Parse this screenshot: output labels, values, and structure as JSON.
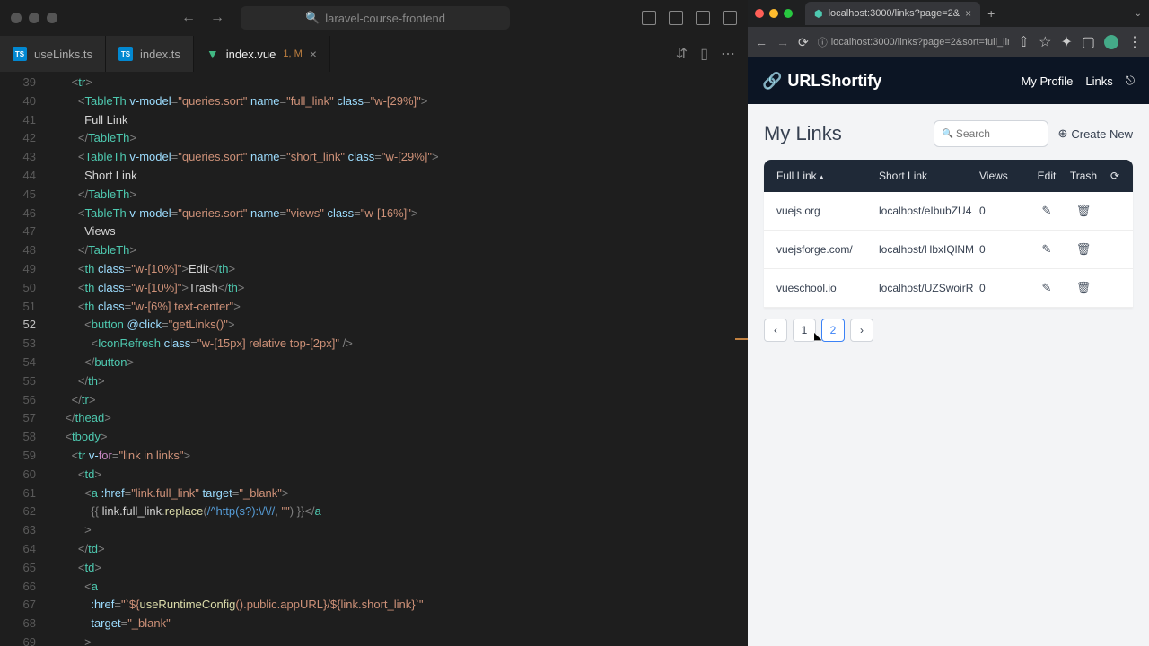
{
  "editor": {
    "project_name": "laravel-course-frontend",
    "tabs": [
      {
        "name": "useLinks.ts",
        "type": "ts"
      },
      {
        "name": "index.ts",
        "type": "ts"
      },
      {
        "name": "index.vue",
        "type": "vue",
        "suffix": "1, M"
      }
    ],
    "line_start": 39,
    "line_end": 69,
    "active_line": 52
  },
  "browser": {
    "tab_title": "localhost:3000/links?page=2&",
    "url_display": "localhost:3000/links?page=2&sort=full_link&fi..."
  },
  "app": {
    "brand": "URLShortify",
    "nav": {
      "profile": "My Profile",
      "links": "Links"
    },
    "page_title": "My Links",
    "search_placeholder": "Search",
    "create_label": "Create New",
    "columns": {
      "full": "Full Link",
      "short": "Short Link",
      "views": "Views",
      "edit": "Edit",
      "trash": "Trash"
    },
    "rows": [
      {
        "full": "vuejs.org",
        "short": "localhost/eIbubZU4",
        "views": "0"
      },
      {
        "full": "vuejsforge.com/",
        "short": "localhost/HbxIQlNM",
        "views": "0"
      },
      {
        "full": "vueschool.io",
        "short": "localhost/UZSwoirR",
        "views": "0"
      }
    ],
    "pagination": {
      "pages": [
        "1",
        "2"
      ],
      "active": "2"
    }
  }
}
